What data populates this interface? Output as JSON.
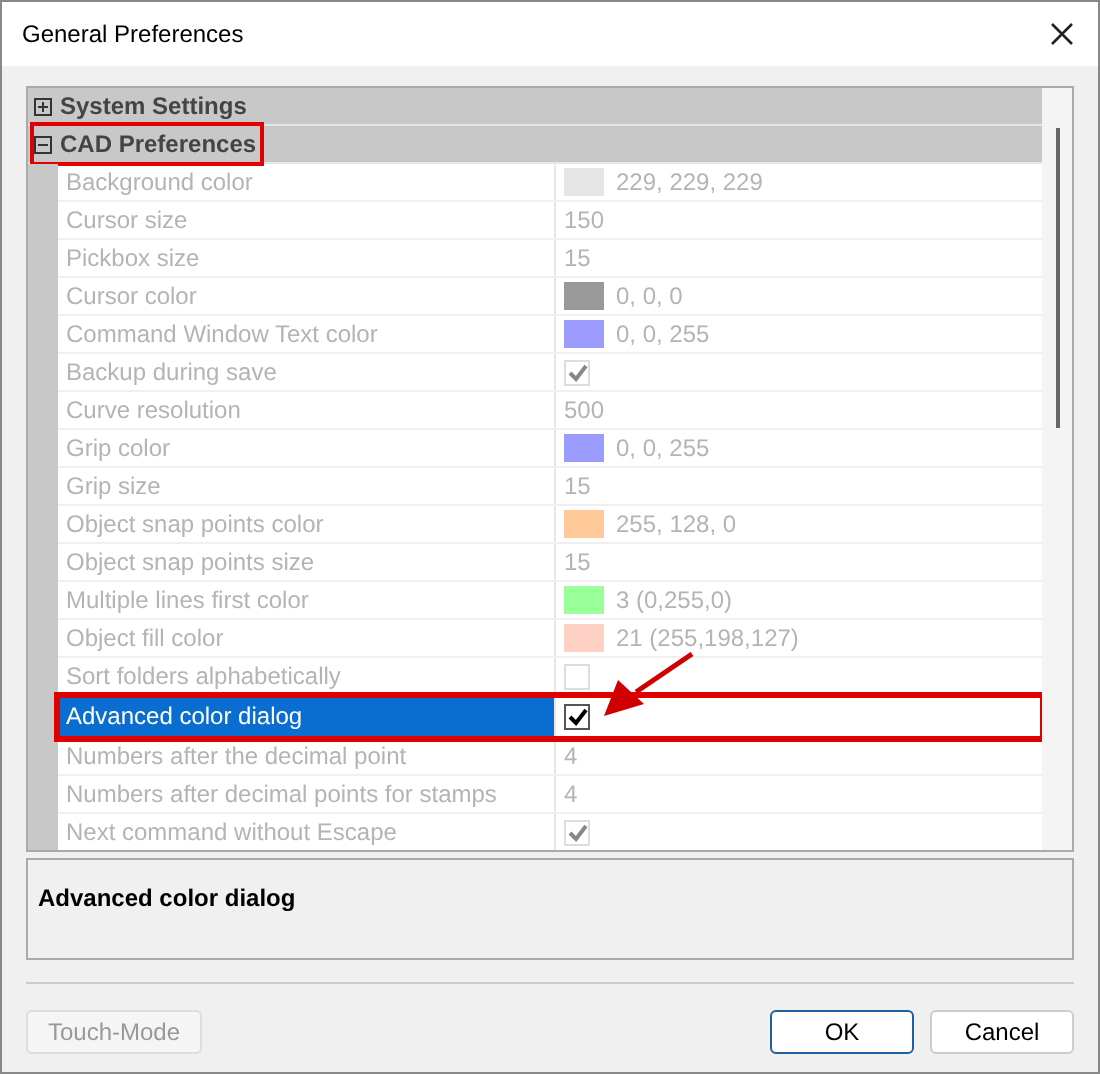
{
  "window": {
    "title": "General Preferences"
  },
  "categories": [
    {
      "label": "System Settings",
      "expanded": false,
      "highlighted": false
    },
    {
      "label": "CAD Preferences",
      "expanded": true,
      "highlighted": true,
      "children": [
        {
          "name": "Background color",
          "kind": "color",
          "color": "#e5e5e5",
          "value": "229, 229, 229",
          "selected": false,
          "highlighted": false
        },
        {
          "name": "Cursor size",
          "kind": "text",
          "value": "150",
          "selected": false,
          "highlighted": false
        },
        {
          "name": "Pickbox size",
          "kind": "text",
          "value": "15",
          "selected": false,
          "highlighted": false
        },
        {
          "name": "Cursor color",
          "kind": "color",
          "color": "#9a9a9a",
          "value": "0, 0, 0",
          "selected": false,
          "highlighted": false
        },
        {
          "name": "Command Window Text color",
          "kind": "color",
          "color": "#9c9cff",
          "value": "0, 0, 255",
          "selected": false,
          "highlighted": false
        },
        {
          "name": "Backup during save",
          "kind": "checkbox",
          "checked": true,
          "selected": false,
          "highlighted": false
        },
        {
          "name": "Curve resolution",
          "kind": "text",
          "value": "500",
          "selected": false,
          "highlighted": false
        },
        {
          "name": "Grip color",
          "kind": "color",
          "color": "#9c9cff",
          "value": "0, 0, 255",
          "selected": false,
          "highlighted": false
        },
        {
          "name": "Grip size",
          "kind": "text",
          "value": "15",
          "selected": false,
          "highlighted": false
        },
        {
          "name": "Object snap points color",
          "kind": "color",
          "color": "#ffc999",
          "value": "255, 128, 0",
          "selected": false,
          "highlighted": false
        },
        {
          "name": "Object snap points size",
          "kind": "text",
          "value": "15",
          "selected": false,
          "highlighted": false
        },
        {
          "name": "Multiple lines first color",
          "kind": "color",
          "color": "#99ff99",
          "value": "3 (0,255,0)",
          "selected": false,
          "highlighted": false
        },
        {
          "name": "Object fill color",
          "kind": "color",
          "color": "#ffd0c4",
          "value": "21 (255,198,127)",
          "selected": false,
          "highlighted": false
        },
        {
          "name": "Sort folders alphabetically",
          "kind": "checkbox",
          "checked": false,
          "selected": false,
          "highlighted": false
        },
        {
          "name": "Advanced color dialog",
          "kind": "checkbox",
          "checked": true,
          "selected": true,
          "highlighted": true
        },
        {
          "name": "Numbers after the decimal point",
          "kind": "text",
          "value": "4",
          "selected": false,
          "highlighted": false
        },
        {
          "name": "Numbers after decimal points for stamps",
          "kind": "text",
          "value": "4",
          "selected": false,
          "highlighted": false
        },
        {
          "name": "Next command without Escape",
          "kind": "checkbox",
          "checked": true,
          "selected": false,
          "highlighted": false
        }
      ]
    }
  ],
  "description": {
    "title": "Advanced color dialog"
  },
  "buttons": [
    {
      "label": "Touch-Mode",
      "disabled": true,
      "default": false
    },
    {
      "label": "OK",
      "disabled": false,
      "default": true
    },
    {
      "label": "Cancel",
      "disabled": false,
      "default": false
    }
  ]
}
